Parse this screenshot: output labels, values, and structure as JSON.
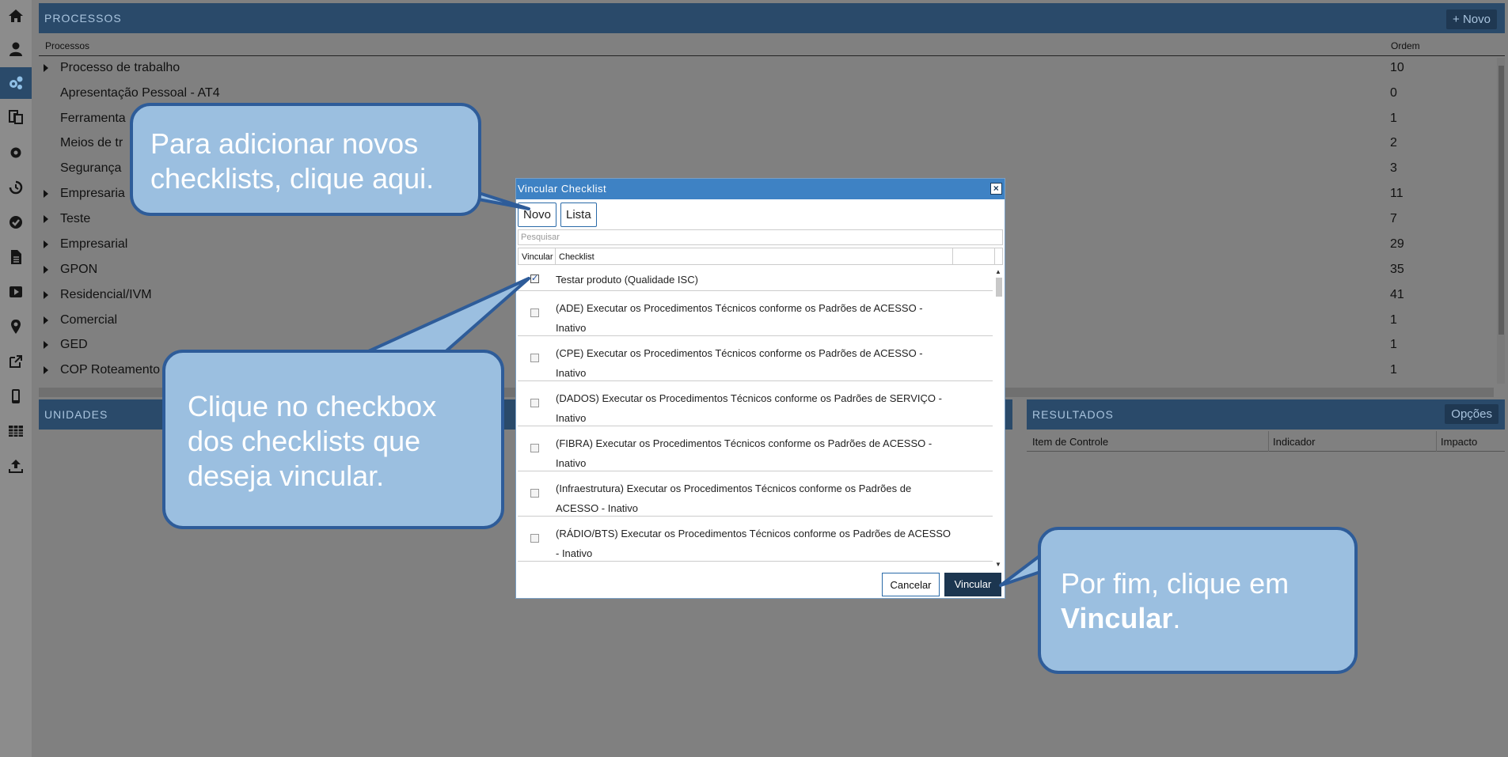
{
  "sidebar": {
    "icons": [
      "home-icon",
      "user-icon",
      "gears-icon",
      "copy-icon",
      "settings-icon",
      "history-icon",
      "check-circle-icon",
      "document-icon",
      "play-icon",
      "map-marker-icon",
      "external-link-icon",
      "mobile-icon",
      "table-icon",
      "upload-icon"
    ],
    "active": "gears-icon"
  },
  "processes": {
    "title": "PROCESSOS",
    "new_button": "+ Novo",
    "col_name": "Processos",
    "col_order": "Ordem",
    "rows": [
      {
        "name": "Processo de trabalho",
        "order": "10",
        "expandable": true
      },
      {
        "name": "Apresentação Pessoal - AT4",
        "order": "0",
        "expandable": false
      },
      {
        "name": "Ferramenta",
        "order": "1",
        "expandable": false
      },
      {
        "name": "Meios de tr",
        "order": "2",
        "expandable": false
      },
      {
        "name": "Segurança",
        "order": "3",
        "expandable": false
      },
      {
        "name": "Empresaria",
        "order": "11",
        "expandable": true
      },
      {
        "name": "Teste",
        "order": "7",
        "expandable": true
      },
      {
        "name": "Empresarial",
        "order": "29",
        "expandable": true
      },
      {
        "name": "GPON",
        "order": "35",
        "expandable": true
      },
      {
        "name": "Residencial/IVM",
        "order": "41",
        "expandable": true
      },
      {
        "name": "Comercial",
        "order": "1",
        "expandable": true
      },
      {
        "name": "GED",
        "order": "1",
        "expandable": true
      },
      {
        "name": "COP Roteamento",
        "order": "1",
        "expandable": true
      }
    ]
  },
  "units": {
    "title": "UNIDADES"
  },
  "results": {
    "title": "RESULTADOS",
    "options_button": "Opções",
    "columns": [
      "Item de Controle",
      "Indicador",
      "Impacto"
    ]
  },
  "modal": {
    "title": "Vincular Checklist",
    "close": "×",
    "novo_button": "Novo",
    "lista_button": "Lista",
    "search_placeholder": "Pesquisar",
    "col_vincular": "Vincular",
    "col_checklist": "Checklist",
    "items": [
      {
        "label": "Testar produto (Qualidade ISC)",
        "checked": true
      },
      {
        "label": "(ADE) Executar os Procedimentos Técnicos conforme os Padrões de ACESSO - Inativo",
        "checked": false
      },
      {
        "label": "(CPE) Executar os Procedimentos Técnicos conforme os Padrões de ACESSO - Inativo",
        "checked": false
      },
      {
        "label": "(DADOS) Executar os Procedimentos Técnicos conforme os Padrões de SERVIÇO - Inativo",
        "checked": false
      },
      {
        "label": "(FIBRA) Executar os Procedimentos Técnicos conforme os Padrões de ACESSO - Inativo",
        "checked": false
      },
      {
        "label": "(Infraestrutura) Executar os Procedimentos Técnicos conforme os Padrões de ACESSO - Inativo",
        "checked": false
      },
      {
        "label": "(RÁDIO/BTS) Executar os Procedimentos Técnicos conforme os Padrões de ACESSO - Inativo",
        "checked": false
      }
    ],
    "cancel_button": "Cancelar",
    "vincular_button": "Vincular"
  },
  "callouts": {
    "top_line1": "Para adicionar novos",
    "top_line2": "checklists, clique aqui.",
    "mid_line1": "Clique no checkbox",
    "mid_line2": "dos checklists que",
    "mid_line3": "deseja vincular.",
    "right_line1": "Por fim, clique em",
    "right_bold": "Vincular",
    "right_end": "."
  },
  "colors": {
    "header_bg": "#2a4a6a",
    "modal_title_bg": "#3e82c4",
    "callout_fill": "#9bbfe0",
    "callout_border": "#2e5c99",
    "primary_button": "#1c3650"
  }
}
